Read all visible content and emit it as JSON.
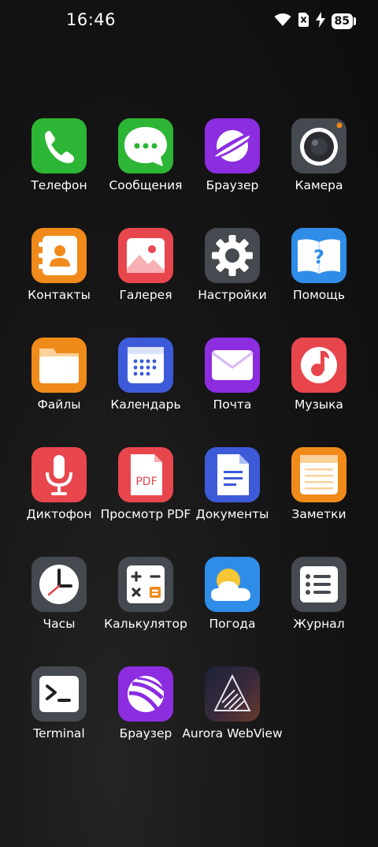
{
  "status": {
    "time": "16:46",
    "battery": "85"
  },
  "apps": [
    {
      "label": "Телефон",
      "icon": "phone-icon",
      "color": "#2db535"
    },
    {
      "label": "Сообщения",
      "icon": "messages-icon",
      "color": "#2db535"
    },
    {
      "label": "Браузер",
      "icon": "browser-planet-icon",
      "color": "#8c2de0"
    },
    {
      "label": "Камера",
      "icon": "camera-icon",
      "color": "#454950"
    },
    {
      "label": "Контакты",
      "icon": "contacts-icon",
      "color": "#f08a1a"
    },
    {
      "label": "Галерея",
      "icon": "gallery-icon",
      "color": "#e8464d"
    },
    {
      "label": "Настройки",
      "icon": "settings-gear-icon",
      "color": "#454950"
    },
    {
      "label": "Помощь",
      "icon": "help-book-icon",
      "color": "#2f8de8"
    },
    {
      "label": "Файлы",
      "icon": "folder-icon",
      "color": "#f08a1a"
    },
    {
      "label": "Календарь",
      "icon": "calendar-icon",
      "color": "#3d5bd8"
    },
    {
      "label": "Почта",
      "icon": "mail-icon",
      "color": "#8c2de0"
    },
    {
      "label": "Музыка",
      "icon": "music-icon",
      "color": "#e8464d"
    },
    {
      "label": "Диктофон",
      "icon": "microphone-icon",
      "color": "#e8464d"
    },
    {
      "label": "Просмотр PDF",
      "icon": "pdf-icon",
      "color": "#e8464d"
    },
    {
      "label": "Документы",
      "icon": "document-icon",
      "color": "#3d5bd8"
    },
    {
      "label": "Заметки",
      "icon": "notes-icon",
      "color": "#f08a1a"
    },
    {
      "label": "Часы",
      "icon": "clock-icon",
      "color": "#454950"
    },
    {
      "label": "Калькулятор",
      "icon": "calculator-icon",
      "color": "#454950"
    },
    {
      "label": "Погода",
      "icon": "weather-icon",
      "color": "#2f8de8"
    },
    {
      "label": "Журнал",
      "icon": "journal-list-icon",
      "color": "#454950"
    },
    {
      "label": "Terminal",
      "icon": "terminal-icon",
      "color": "#454950"
    },
    {
      "label": "Браузер",
      "icon": "browser-sphere-icon",
      "color": "#8c2de0"
    },
    {
      "label": "Aurora WebView",
      "icon": "aurora-webview-icon",
      "color": "#2a2a3a"
    }
  ]
}
